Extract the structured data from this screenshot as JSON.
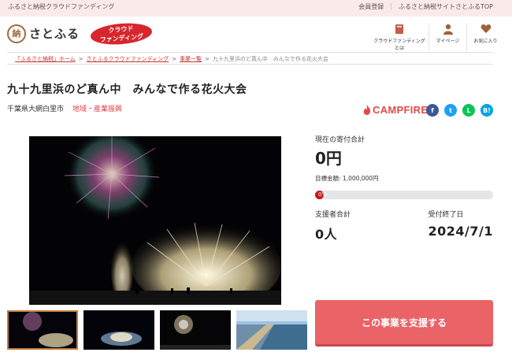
{
  "topbar": {
    "tagline": "ふるさと納税クラウドファンディング",
    "links": [
      "会員登録",
      "ふるさと納税サイトさとふるTOP"
    ]
  },
  "header": {
    "logo_mark": "納",
    "logo_text": "さとふる",
    "cf_badge_line1": "クラウド",
    "cf_badge_line2": "ファンディング",
    "nav": [
      {
        "label": "クラウドファンディングとは",
        "icon": "book-icon"
      },
      {
        "label": "マイページ",
        "icon": "user-icon"
      },
      {
        "label": "お気に入り",
        "icon": "heart-icon"
      }
    ]
  },
  "breadcrumb": {
    "items": [
      "「ふるさと納税」ホーム",
      "さとふるクラウドファンディング",
      "事業一覧"
    ],
    "current": "九十九里浜のど真ん中　みんなで作る花火大会"
  },
  "project": {
    "title": "九十九里浜のど真ん中　みんなで作る花火大会",
    "location": "千葉県大網白里市",
    "category": "地域・産業振興",
    "platform": "CAMPFIRE"
  },
  "share": [
    {
      "icon": "facebook-icon",
      "glyph": "f",
      "color": "#3b5998"
    },
    {
      "icon": "twitter-icon",
      "glyph": "t",
      "color": "#1da1f2"
    },
    {
      "icon": "line-icon",
      "glyph": "L",
      "color": "#06c755"
    },
    {
      "icon": "hatena-icon",
      "glyph": "B!",
      "color": "#00a4de"
    }
  ],
  "funding": {
    "current_label": "現在の寄付合計",
    "current_amount": "0円",
    "goal_text": "目標金額: 1,000,000円",
    "progress_percent": 0,
    "progress_text": "0%",
    "supporters_label": "支援者合計",
    "supporters_value": "0人",
    "deadline_label": "受付終了日",
    "deadline_value": "2024/7/1"
  },
  "support_button": "この事業を支援する",
  "colors": {
    "accent": "#e96367",
    "brand_red": "#d7262d",
    "topbar_bg": "#fbeaea"
  }
}
